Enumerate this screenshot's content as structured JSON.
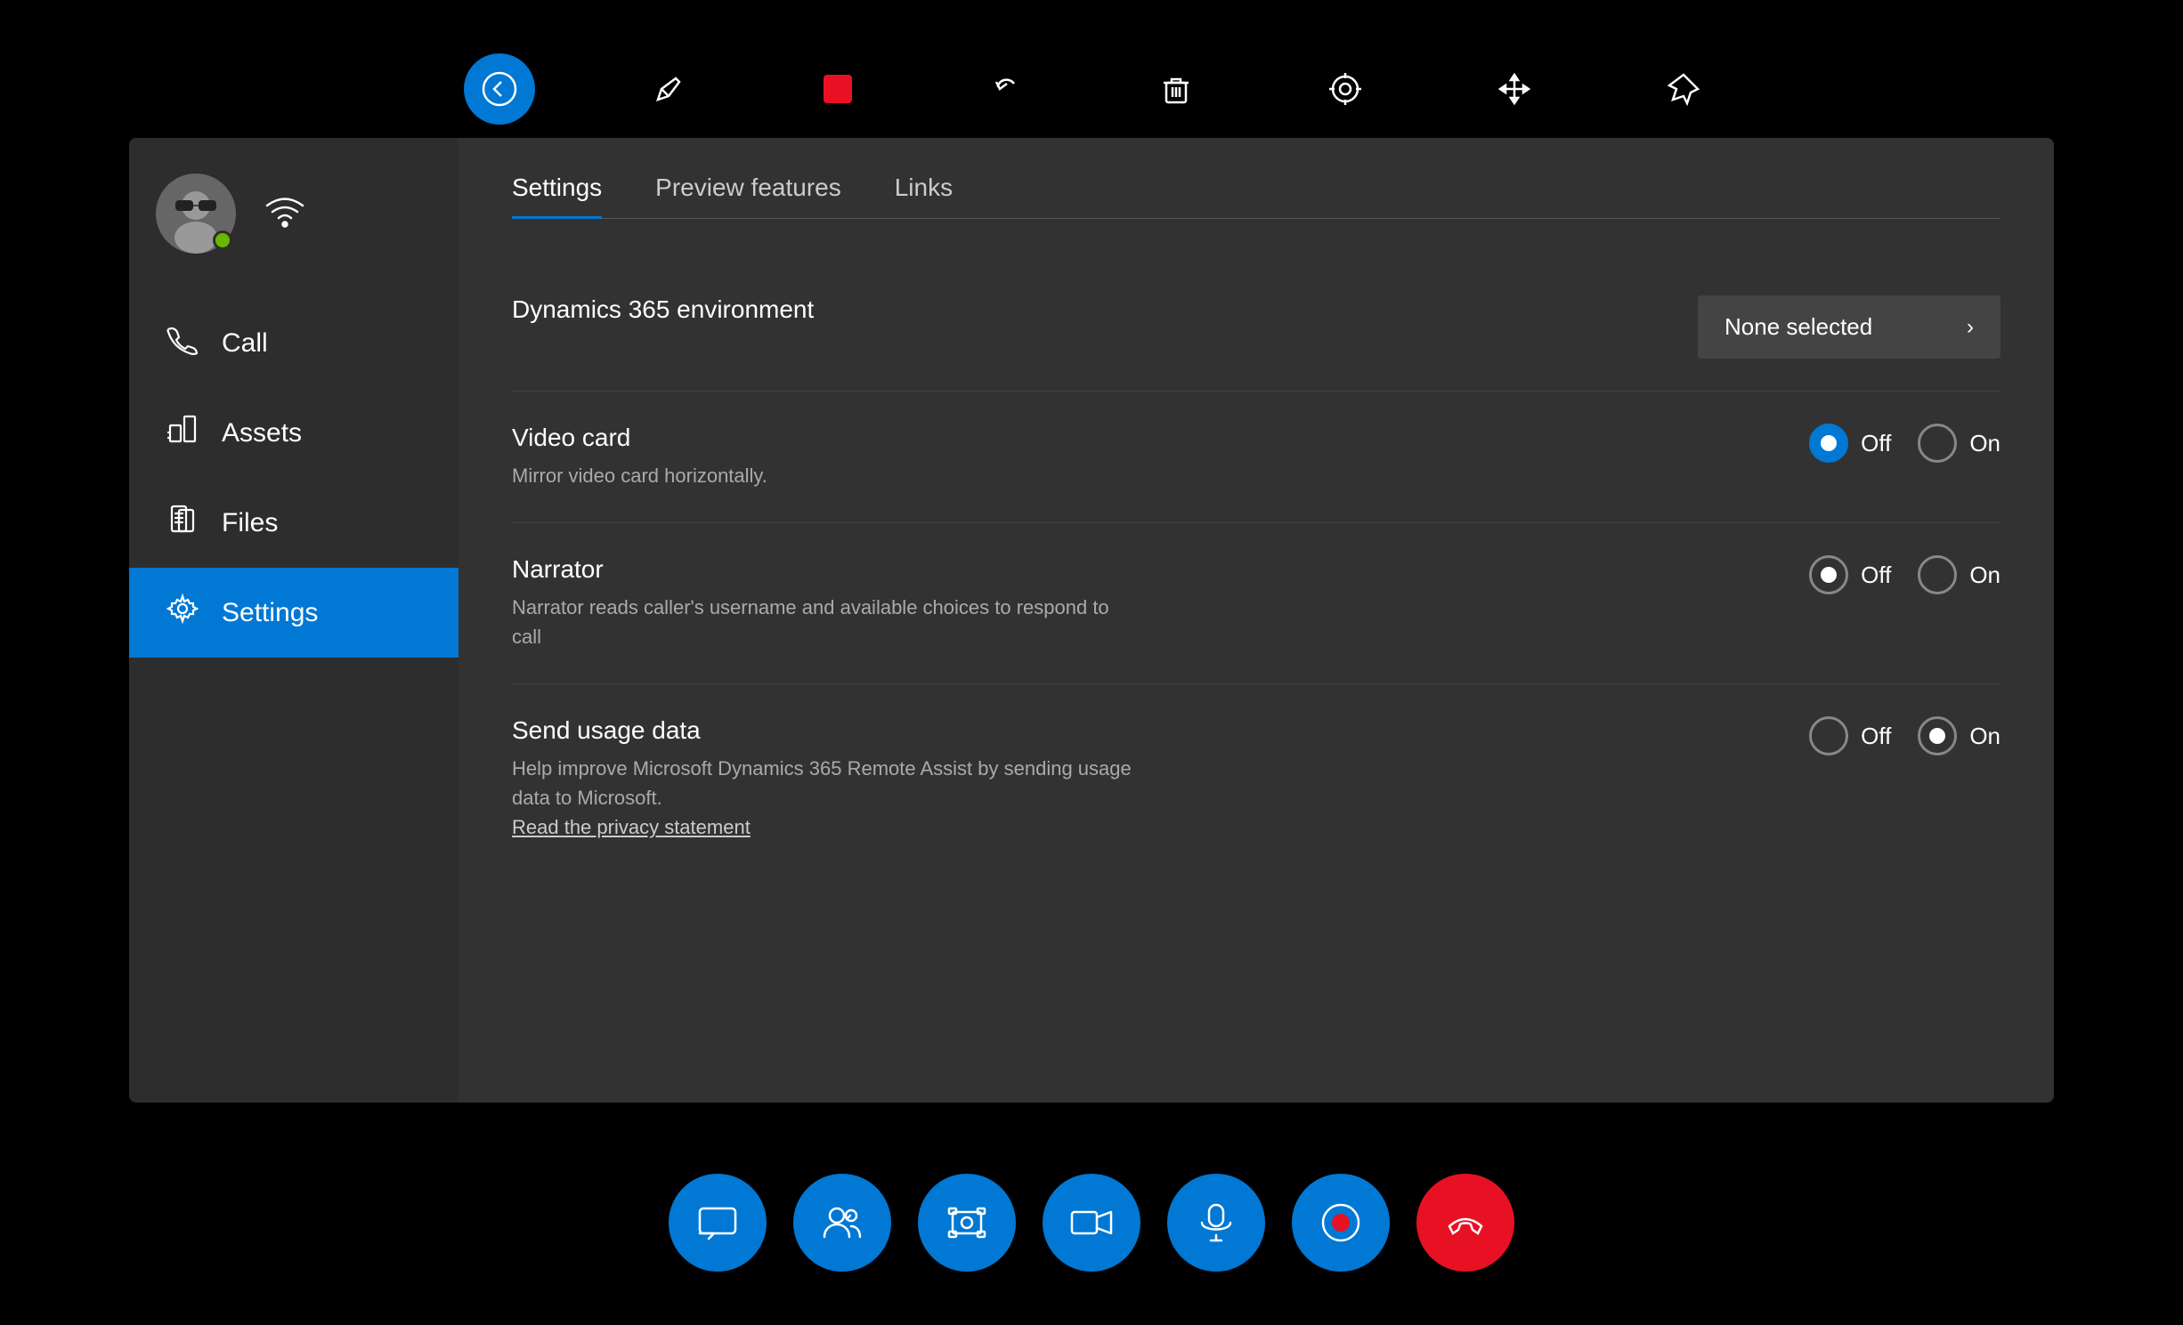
{
  "toolbar": {
    "back_label": "←",
    "pen_label": "✏",
    "stop_label": "■",
    "undo_label": "↩",
    "trash_label": "🗑",
    "target_label": "◎",
    "move_label": "✥",
    "pin_label": "📌"
  },
  "sidebar": {
    "user_name": "User",
    "nav_items": [
      {
        "id": "call",
        "label": "Call"
      },
      {
        "id": "assets",
        "label": "Assets"
      },
      {
        "id": "files",
        "label": "Files"
      },
      {
        "id": "settings",
        "label": "Settings"
      }
    ]
  },
  "content": {
    "tabs": [
      {
        "id": "settings",
        "label": "Settings"
      },
      {
        "id": "preview",
        "label": "Preview features"
      },
      {
        "id": "links",
        "label": "Links"
      }
    ],
    "active_tab": "settings",
    "settings_rows": [
      {
        "id": "dynamics365",
        "label": "Dynamics 365 environment",
        "desc": "",
        "control": "dropdown",
        "value": "None selected"
      },
      {
        "id": "video_card",
        "label": "Video card",
        "desc": "Mirror video card horizontally.",
        "control": "radio",
        "off_selected": true,
        "on_selected": false
      },
      {
        "id": "narrator",
        "label": "Narrator",
        "desc": "Narrator reads caller's username and available choices to respond to call",
        "control": "radio",
        "off_selected": true,
        "on_selected": false
      },
      {
        "id": "send_usage",
        "label": "Send usage data",
        "desc": "Help improve Microsoft Dynamics 365 Remote Assist by sending usage data to Microsoft.",
        "control": "radio",
        "off_selected": false,
        "on_selected": true,
        "link": "Read the privacy statement"
      }
    ]
  },
  "bottom_toolbar": {
    "chat": "💬",
    "participants": "👥",
    "screenshot": "📷",
    "camera": "📹",
    "mic": "🎙",
    "record": "⏺",
    "end": "📞"
  }
}
